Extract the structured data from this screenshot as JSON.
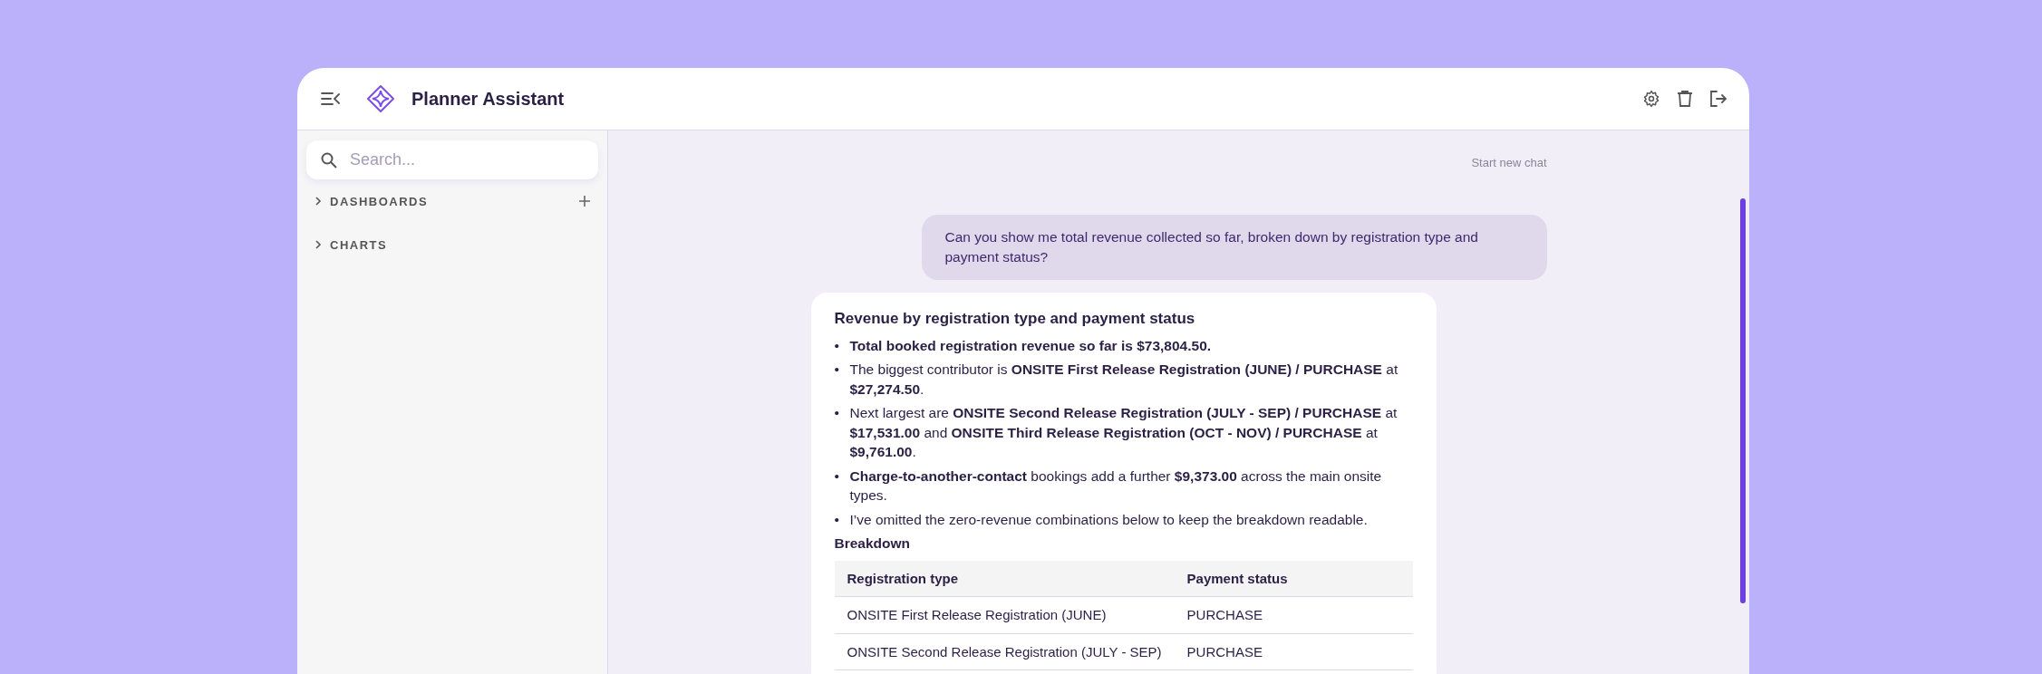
{
  "app": {
    "title": "Planner Assistant"
  },
  "sidebar": {
    "search": {
      "placeholder": "Search..."
    },
    "sections": [
      {
        "label": "DASHBOARDS",
        "expanded": false,
        "can_add": true
      },
      {
        "label": "CHARTS",
        "expanded": false,
        "can_add": false
      }
    ]
  },
  "chat": {
    "new_chat": "Start new chat",
    "messages": [
      {
        "kind": "user",
        "text": "Can you show me total revenue collected so far, broken down by registration type and payment status?"
      },
      {
        "kind": "assistant",
        "title": "Revenue by registration type and payment status",
        "bullets": [
          {
            "marker": "•",
            "text": "**Total booked registration revenue so far is $73,804.50.**"
          },
          {
            "marker": "•",
            "text": "The biggest contributor is **ONSITE First Release Registration (JUNE) / PURCHASE** at **$27,274.50**."
          },
          {
            "marker": "•",
            "text": "Next largest are **ONSITE Second Release Registration (JULY - SEP) / PURCHASE** at **$17,531.00** and **ONSITE Third Release Registration (OCT - NOV) / PURCHASE** at **$9,761.00**."
          },
          {
            "marker": "•",
            "text": "**Charge-to-another-contact** bookings add a further **$9,373.00** across the main onsite types."
          },
          {
            "marker": "•",
            "text": "I’ve omitted the zero-revenue combinations below to keep the breakdown readable."
          }
        ],
        "subheading": "Breakdown",
        "table": {
          "columns": [
            "Registration type",
            "Payment status"
          ],
          "rows": [
            [
              "ONSITE First Release Registration (JUNE)",
              "PURCHASE"
            ],
            [
              "ONSITE Second Release Registration (JULY - SEP)",
              "PURCHASE"
            ]
          ]
        }
      }
    ]
  }
}
